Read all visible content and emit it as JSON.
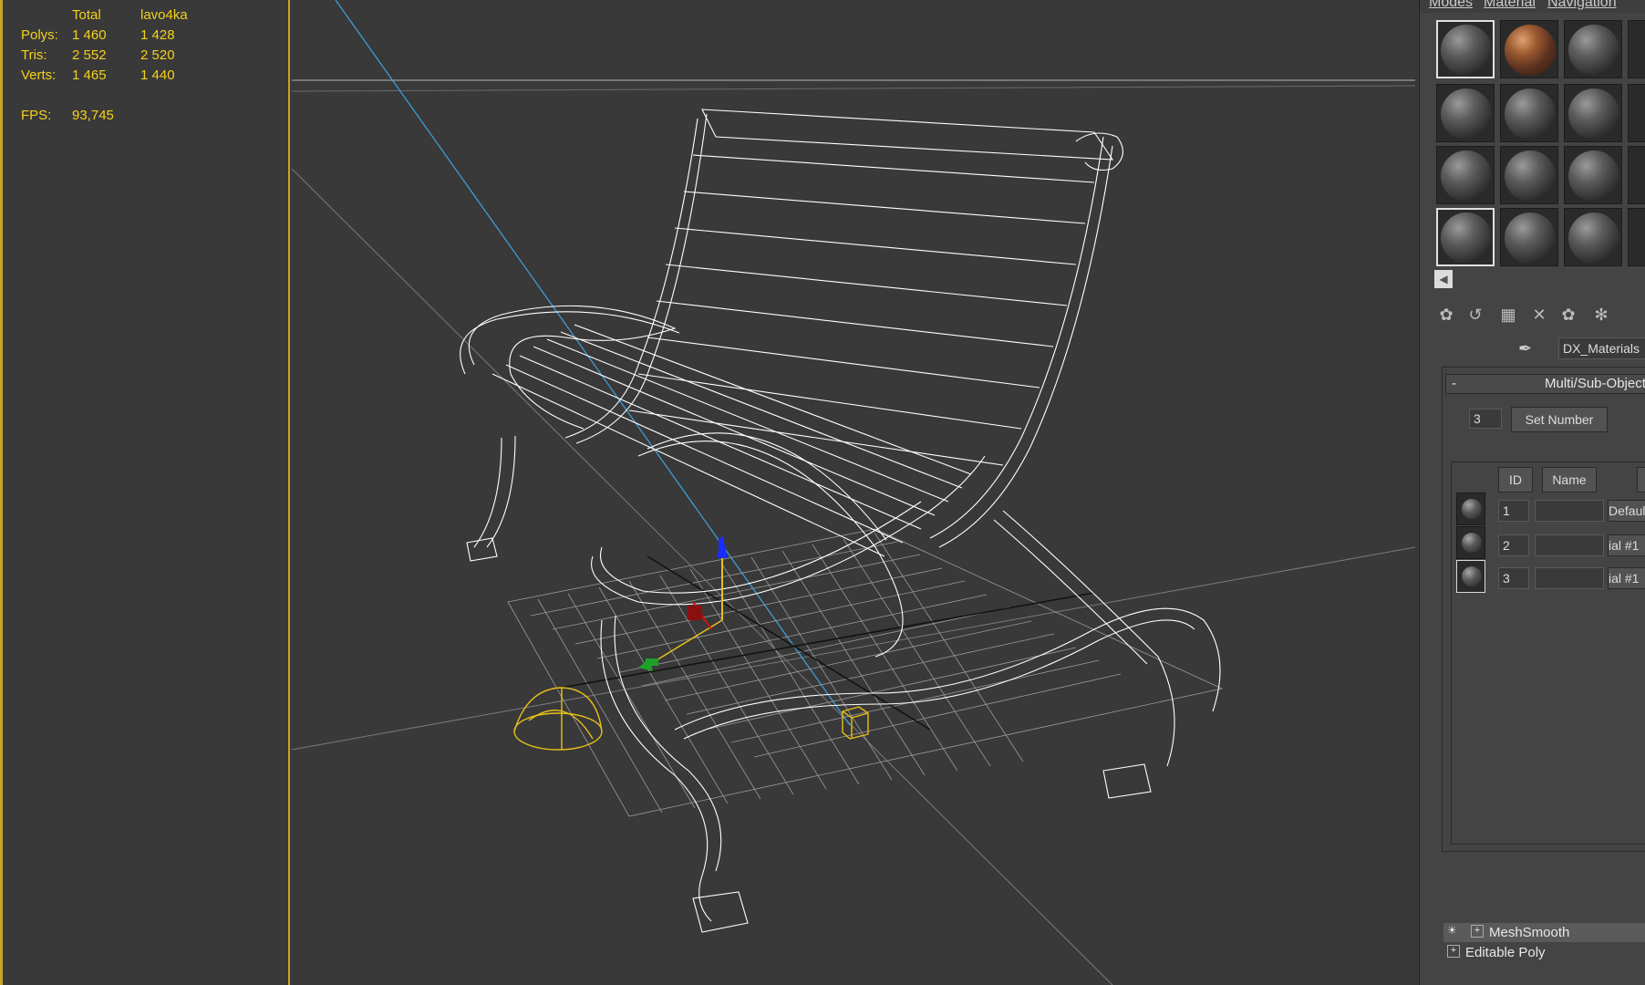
{
  "stats": {
    "headers": [
      "Total",
      "lavo4ka"
    ],
    "rows": [
      {
        "label": "Polys:",
        "total": "1 460",
        "sel": "1 428"
      },
      {
        "label": "Tris:",
        "total": "2 552",
        "sel": "2 520"
      },
      {
        "label": "Verts:",
        "total": "1 465",
        "sel": "1 440"
      }
    ],
    "fps_label": "FPS:",
    "fps_value": "93,745"
  },
  "menu": [
    "Modes",
    "Material",
    "Navigation"
  ],
  "material_dropdown": "DX_Materials",
  "rollout_title": "Multi/Sub-Object",
  "rollout_collapse": "-",
  "set_number_value": "3",
  "set_number_label": "Set Number",
  "table_headers": {
    "id": "ID",
    "name": "Name"
  },
  "sub_materials": [
    {
      "id": "1",
      "name": "",
      "material": "Defaul"
    },
    {
      "id": "2",
      "name": "",
      "material": "ial #1"
    },
    {
      "id": "3",
      "name": "",
      "material": "ial #1"
    }
  ],
  "modifier_stack": [
    "MeshSmooth",
    "Editable Poly"
  ],
  "colors": {
    "stats_text": "#f3d11a",
    "viewport_bg": "#393939",
    "wire": "#ffffff",
    "accent_border": "#c9a22a"
  }
}
